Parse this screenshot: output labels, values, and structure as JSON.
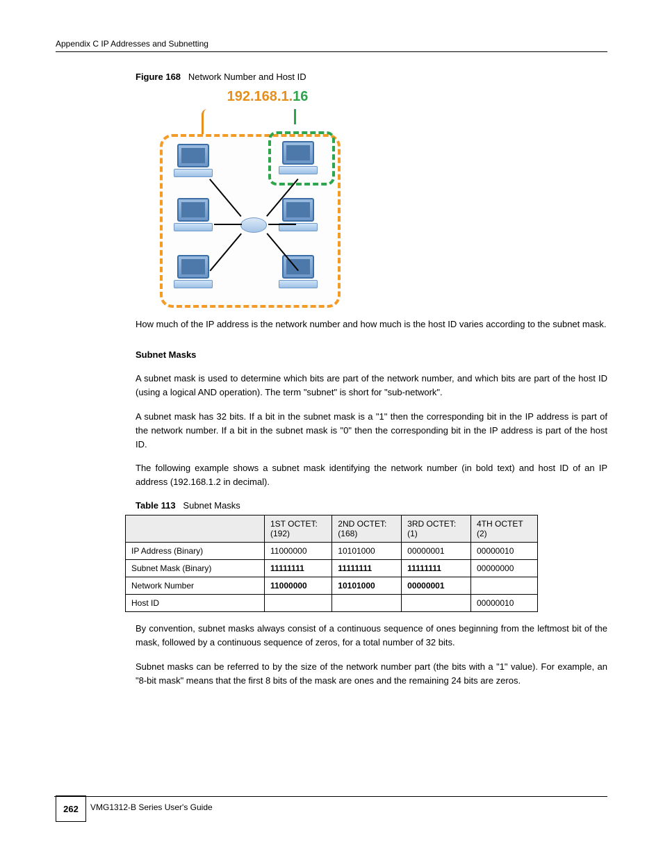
{
  "header": "Appendix C IP Addresses and Subnetting",
  "figure": {
    "label": "Figure 168",
    "title": "Network Number and Host ID",
    "ip_network": "192.168.1.",
    "ip_host": "16"
  },
  "paragraphs": {
    "p1": "How much of the IP address is the network number and how much is the host ID varies according to the subnet mask.",
    "sub_heading": "Subnet Masks",
    "p2a": "A subnet mask is used to determine which bits are part of the network number, and which bits are part of the host ID (using a logical AND operation). The term \"subnet\" is short for \"sub-network\".",
    "p2b": "A subnet mask has 32 bits. If a bit in the subnet mask is a \"1\" then the corresponding bit in the IP address is part of the network number. If a bit in the subnet mask is \"0\" then the corresponding bit in the IP address is part of the host ID.",
    "p2c": "The following example shows a subnet mask identifying the network number (in bold text) and host ID of an IP address (192.168.1.2 in decimal)."
  },
  "table": {
    "label": "Table 113",
    "title": "Subnet Masks",
    "headers": [
      "",
      "1ST OCTET:\n(192)",
      "2ND OCTET:\n(168)",
      "3RD OCTET:\n(1)",
      "4TH OCTET\n(2)"
    ],
    "rows": [
      [
        "IP Address (Binary)",
        "11000000",
        "10101000",
        "00000001",
        "00000010"
      ],
      [
        "Subnet Mask (Binary)",
        "11111111",
        "11111111",
        "11111111",
        "00000000"
      ],
      [
        "Network Number",
        "11000000",
        "10101000",
        "00000001",
        ""
      ],
      [
        "Host ID",
        "",
        "",
        "",
        "00000010"
      ]
    ]
  },
  "after_table": {
    "p3": "By convention, subnet masks always consist of a continuous sequence of ones beginning from the leftmost bit of the mask, followed by a continuous sequence of zeros, for a total number of 32 bits.",
    "p4": "Subnet masks can be referred to by the size of the network number part (the bits with a \"1\" value). For example, an \"8-bit mask\" means that the first 8 bits of the mask are ones and the remaining 24 bits are zeros."
  },
  "footer": {
    "text": "VMG1312-B Series User's Guide",
    "page": "262"
  }
}
